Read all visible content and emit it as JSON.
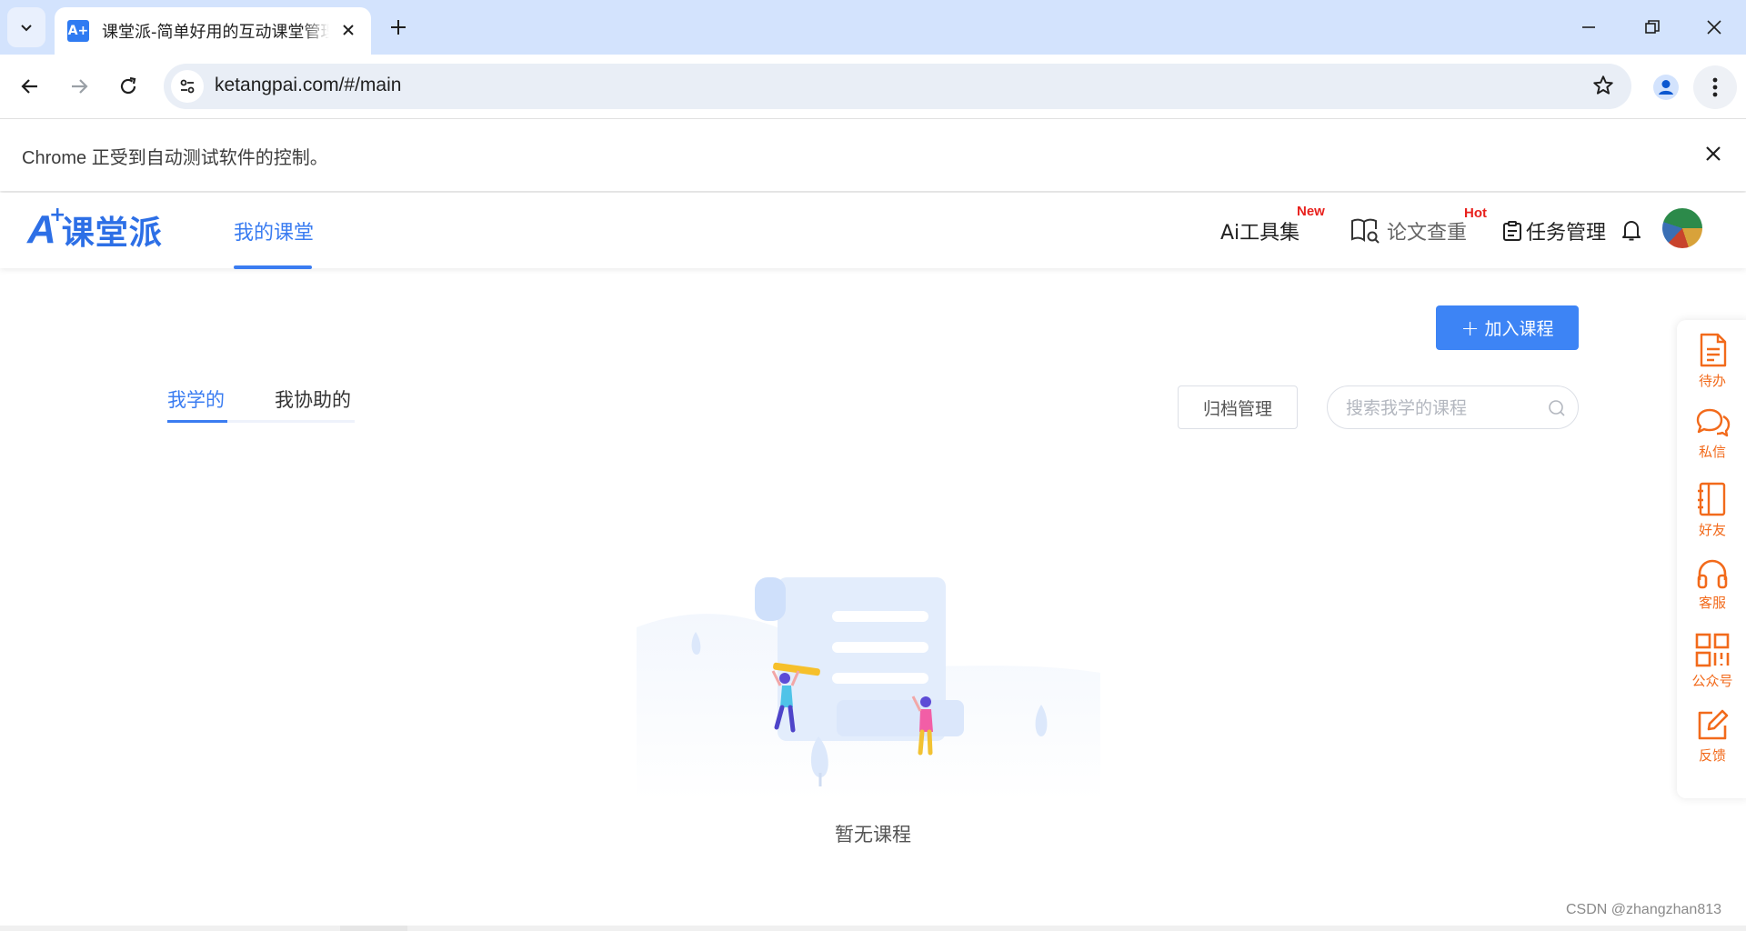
{
  "browser": {
    "tab_title": "课堂派-简单好用的互动课堂管理",
    "tab_favicon_text": "A+",
    "url": "ketangpai.com/#/main",
    "infobar_text": "Chrome 正受到自动测试软件的控制。"
  },
  "header": {
    "logo_text": "课堂派",
    "logo_letter": "A",
    "logo_plus": "+",
    "nav_active": "我的课堂",
    "ai_tools": "Ai工具集",
    "ai_badge": "New",
    "paper_check": "论文查重",
    "paper_badge": "Hot",
    "task_manage": "任务管理"
  },
  "main": {
    "join_button": "加入课程",
    "join_plus": "+",
    "tabs": [
      "我学的",
      "我协助的"
    ],
    "archive_button": "归档管理",
    "search_placeholder": "搜索我学的课程",
    "empty_text": "暂无课程"
  },
  "sidebar": {
    "items": [
      {
        "label": "待办",
        "icon": "document-icon"
      },
      {
        "label": "私信",
        "icon": "chat-icon"
      },
      {
        "label": "好友",
        "icon": "contacts-book-icon"
      },
      {
        "label": "客服",
        "icon": "headset-icon"
      },
      {
        "label": "公众号",
        "icon": "qrcode-icon"
      },
      {
        "label": "反馈",
        "icon": "edit-icon"
      }
    ],
    "accent": "#f26a1b"
  },
  "colors": {
    "primary": "#3d84f5",
    "badge_red": "#e8211d",
    "chrome_tabbar": "#d3e3fd"
  },
  "watermark": "CSDN @zhangzhan813"
}
